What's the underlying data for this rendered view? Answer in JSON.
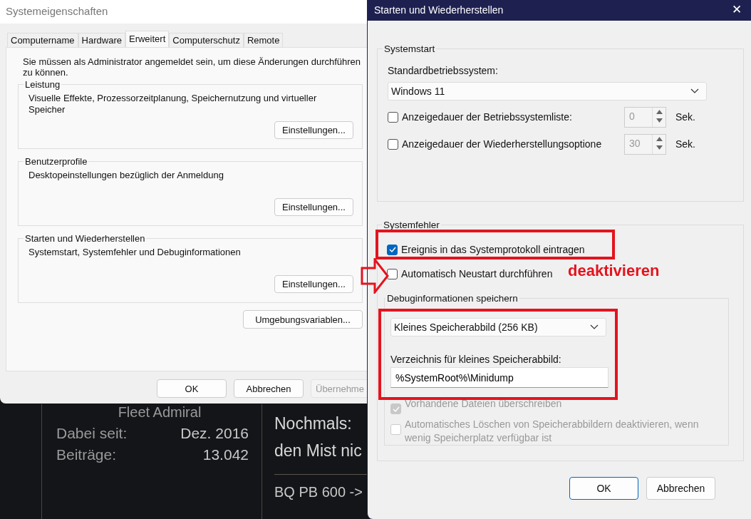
{
  "background_page": {
    "member_rank": "Fleet Admiral",
    "stats": [
      {
        "label": "Dabei seit:",
        "value": "Dez. 2016"
      },
      {
        "label": "Beiträge:",
        "value": "13.042"
      }
    ],
    "post_lines": [
      "Nochmals:",
      "den Mist nic"
    ],
    "next_post": "BQ PB 600 ->"
  },
  "system_properties": {
    "title": "Systemeigenschaften",
    "tabs": [
      {
        "label": "Computername",
        "selected": false
      },
      {
        "label": "Hardware",
        "selected": false
      },
      {
        "label": "Erweitert",
        "selected": true
      },
      {
        "label": "Computerschutz",
        "selected": false
      },
      {
        "label": "Remote",
        "selected": false
      }
    ],
    "notice": "Sie müssen als Administrator angemeldet sein, um diese Änderungen durchführen zu können.",
    "groups": [
      {
        "title": "Leistung",
        "description": "Visuelle Effekte, Prozessorzeitplanung, Speichernutzung und virtueller Speicher",
        "button": "Einstellungen..."
      },
      {
        "title": "Benutzerprofile",
        "description": "Desktopeinstellungen bezüglich der Anmeldung",
        "button": "Einstellungen..."
      },
      {
        "title": "Starten und Wiederherstellen",
        "description": "Systemstart, Systemfehler und Debuginformationen",
        "button": "Einstellungen..."
      }
    ],
    "env_button": "Umgebungsvariablen...",
    "buttons": [
      {
        "label": "OK",
        "disabled": false
      },
      {
        "label": "Abbrechen",
        "disabled": false
      },
      {
        "label": "Übernehme",
        "disabled": true
      }
    ]
  },
  "startup_recovery": {
    "title": "Starten und Wiederherstellen",
    "close": "✕",
    "systemstart": {
      "title": "Systemstart",
      "default_os_label": "Standardbetriebssystem:",
      "default_os": "Windows 11",
      "timeouts": [
        {
          "label": "Anzeigedauer der Betriebssystemliste:",
          "checked": false,
          "value": "0",
          "unit": "Sek."
        },
        {
          "label": "Anzeigedauer der Wiederherstellungsoptione",
          "checked": false,
          "value": "30",
          "unit": "Sek."
        }
      ]
    },
    "system_failure": {
      "title": "Systemfehler",
      "options": [
        {
          "label": "Ereignis in das Systemprotokoll eintragen",
          "checked": true
        },
        {
          "label": "Automatisch Neustart durchführen",
          "checked": false
        }
      ],
      "debug": {
        "title": "Debuginformationen speichern",
        "dump_type": "Kleines Speicherabbild (256 KB)",
        "dir_label": "Verzeichnis für kleines Speicherabbild:",
        "dir_value": "%SystemRoot%\\Minidump",
        "options": [
          {
            "label": "Vorhandene Dateien überschreiben",
            "checked": true,
            "disabled": true
          },
          {
            "label": "Automatisches Löschen von Speicherabbildern deaktivieren, wenn wenig Speicherplatz verfügbar ist",
            "checked": false,
            "disabled": true
          }
        ]
      }
    },
    "buttons": [
      {
        "label": "OK",
        "default": true
      },
      {
        "label": "Abbrechen",
        "default": false
      }
    ]
  },
  "annotation": {
    "note": "deaktivieren"
  }
}
